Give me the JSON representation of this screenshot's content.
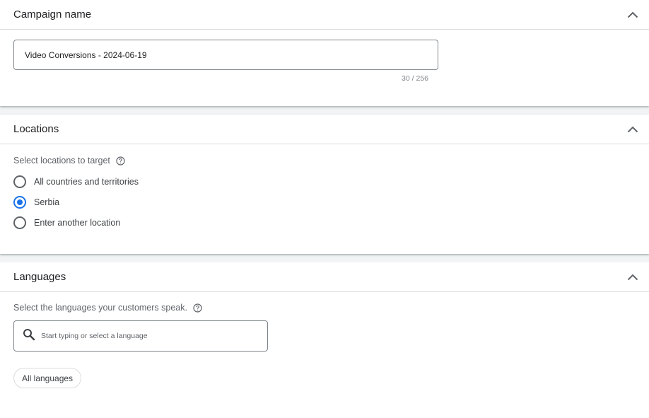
{
  "campaign_name": {
    "title": "Campaign name",
    "value": "Video Conversions - 2024-06-19",
    "counter": "30 / 256",
    "collapse_icon": "chevron-up-icon"
  },
  "locations": {
    "title": "Locations",
    "subtitle": "Select locations to target",
    "help_icon": "help-circle-icon",
    "collapse_icon": "chevron-up-icon",
    "options": [
      {
        "label": "All countries and territories",
        "selected": false
      },
      {
        "label": "Serbia",
        "selected": true
      },
      {
        "label": "Enter another location",
        "selected": false
      }
    ]
  },
  "languages": {
    "title": "Languages",
    "subtitle": "Select the languages your customers speak.",
    "help_icon": "help-circle-icon",
    "collapse_icon": "chevron-up-icon",
    "search_placeholder": "Start typing or select a language",
    "search_value": "",
    "chips": [
      "All languages"
    ]
  },
  "colors": {
    "accent": "#1a73e8",
    "border": "#80868b",
    "divider": "#dadce0",
    "background_gap": "#f1f3f4"
  }
}
